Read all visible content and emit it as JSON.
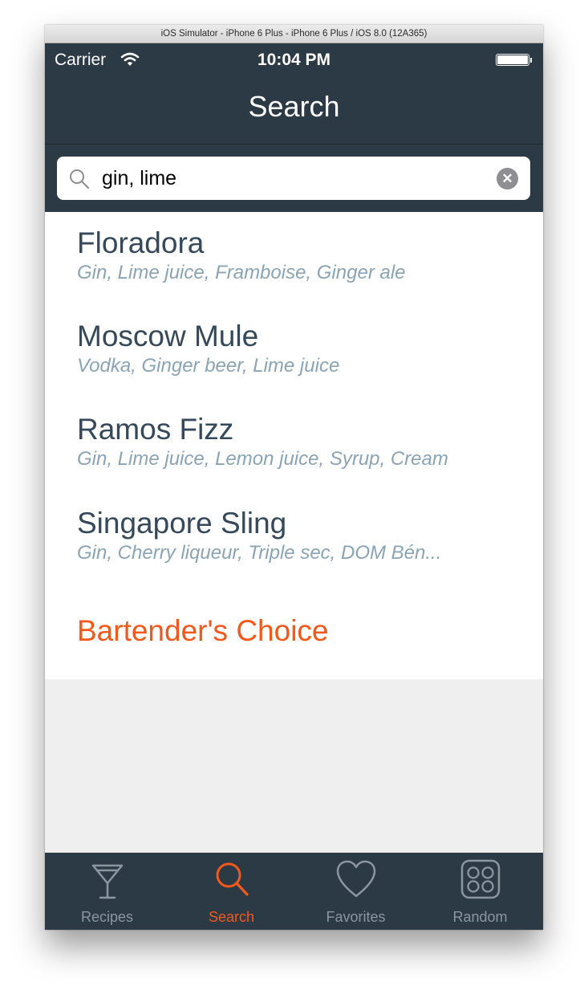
{
  "window": {
    "title": "iOS Simulator - iPhone 6 Plus - iPhone 6 Plus / iOS 8.0 (12A365)"
  },
  "status_bar": {
    "carrier": "Carrier",
    "time": "10:04 PM"
  },
  "nav": {
    "title": "Search"
  },
  "search": {
    "value": "gin, lime",
    "clear_icon": "clear-x-icon"
  },
  "results": [
    {
      "name": "Floradora",
      "ingredients": "Gin, Lime juice, Framboise, Ginger ale"
    },
    {
      "name": "Moscow Mule",
      "ingredients": "Vodka, Ginger beer, Lime juice"
    },
    {
      "name": "Ramos Fizz",
      "ingredients": "Gin, Lime juice, Lemon juice, Syrup, Cream"
    },
    {
      "name": "Singapore Sling",
      "ingredients": "Gin, Cherry liqueur, Triple sec, DOM Bén..."
    }
  ],
  "bartenders_choice": "Bartender's Choice",
  "tabs": [
    {
      "label": "Recipes",
      "icon": "cocktail-glass-icon",
      "active": false
    },
    {
      "label": "Search",
      "icon": "search-icon",
      "active": true
    },
    {
      "label": "Favorites",
      "icon": "heart-icon",
      "active": false
    },
    {
      "label": "Random",
      "icon": "dice-icon",
      "active": false
    }
  ],
  "colors": {
    "header_bg": "#2b3a44",
    "accent": "#f4581b",
    "title_text": "#35495a",
    "subtitle_text": "#8aa4b5",
    "inactive_tab": "#8b97a0"
  }
}
